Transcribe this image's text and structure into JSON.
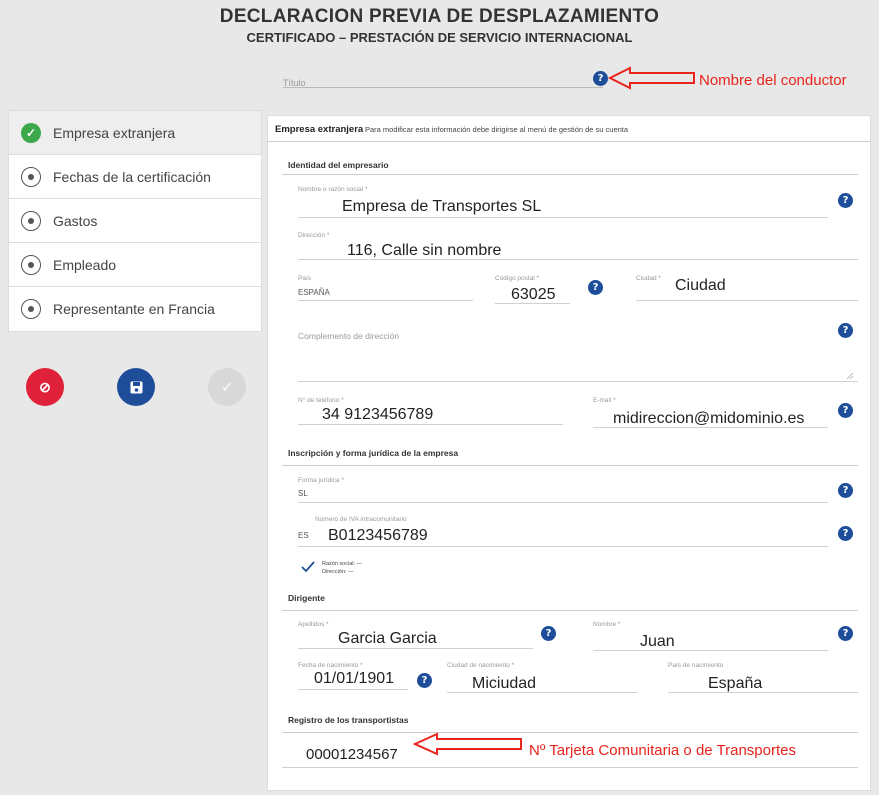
{
  "header": {
    "title": "DECLARACION PREVIA DE DESPLAZAMIENTO",
    "subtitle": "CERTIFICADO – PRESTACIÓN DE SERVICIO INTERNACIONAL"
  },
  "titulo_field": {
    "label": "Título"
  },
  "annotations": {
    "driver": "Nombre del conductor",
    "transport_card": "Nº Tarjeta Comunitaria o de Transportes"
  },
  "sidebar": {
    "items": [
      {
        "label": "Empresa extranjera",
        "icon": "check-circle-icon",
        "active": true
      },
      {
        "label": "Fechas de la certificación",
        "icon": "radio-icon"
      },
      {
        "label": "Gastos",
        "icon": "radio-icon"
      },
      {
        "label": "Empleado",
        "icon": "radio-icon"
      },
      {
        "label": "Representante en Francia",
        "icon": "radio-icon"
      }
    ]
  },
  "actions": {
    "cancel_icon": "⊘",
    "save_icon": "floppy-icon",
    "validate_icon": "✓"
  },
  "card": {
    "title": "Empresa extranjera",
    "note": "Para modificar esta información debe dirigirse al menú de gestión de su cuenta"
  },
  "identity": {
    "section": "Identidad del empresario",
    "name_label": "Nombre o razón social *",
    "name_value": "Empresa de Transportes SL",
    "address_label": "Dirección *",
    "address_value": "116, Calle sin nombre",
    "country_label": "País",
    "country_value": "ESPAÑA",
    "postal_label": "Código postal *",
    "postal_value": "63025",
    "city_label": "Ciudad *",
    "city_value": "Ciudad",
    "complement_label": "Complemento de dirección",
    "phone_label": "N° de teléfono *",
    "phone_value": "34 9123456789",
    "email_label": "E-mail *",
    "email_value": "midireccion@midominio.es"
  },
  "legal": {
    "section": "Inscripción y forma jurídica de la empresa",
    "form_label": "Forma jurídica *",
    "form_value": "SL",
    "vat_label": "Número de IVA intracomunitario",
    "vat_prefix": "ES",
    "vat_value": "B0123456789",
    "check_line1": "Razón social: —",
    "check_line2": "Dirección: —"
  },
  "director": {
    "section": "Dirigente",
    "surname_label": "Apellidos *",
    "surname_value": "Garcia Garcia",
    "name_label": "Nombre *",
    "name_value": "Juan",
    "birthdate_label": "Fecha de nacimiento *",
    "birthdate_value": "01/01/1901",
    "birthcity_label": "Ciudad de nacimiento *",
    "birthcity_value": "Miciudad",
    "birthcountry_label": "País de nacimiento",
    "birthcountry_value": "España"
  },
  "registry": {
    "section": "Registro de los transportistas",
    "value": "00001234567"
  },
  "colors": {
    "help": "#1e4e9a",
    "cancel": "#e0213a",
    "save": "#1e4e9a",
    "disabled": "#d8d8d8",
    "check": "#3aa84b",
    "annotation": "#e8241c"
  }
}
